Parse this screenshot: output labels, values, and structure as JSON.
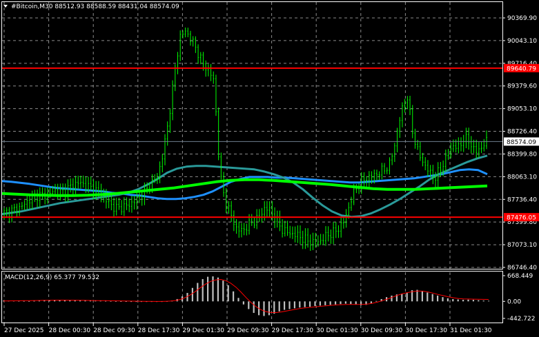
{
  "header": {
    "symbol_line": "#Bitcoin,M30  88512.93 88588.59 88431.04 88574.09"
  },
  "colors": {
    "background": "#000000",
    "grid": "#ffffff",
    "candle": "#00ff00",
    "ma_fast": "#1e90ff",
    "ma_slow": "#00ff00",
    "ma_mid": "#2a9a9a",
    "level_line": "#ff0000",
    "current_price_line": "#708090",
    "macd_hist": "#c0c0c0",
    "macd_signal": "#ff0000"
  },
  "chart_data": {
    "type": "candlestick",
    "price_axis": {
      "ticks": [
        "90369.90",
        "90043.10",
        "89716.40",
        "89379.60",
        "89053.10",
        "88726.40",
        "88399.80",
        "88063.10",
        "87736.40",
        "87399.80",
        "87073.10",
        "86746.40"
      ],
      "ylim": [
        86746.4,
        90369.9
      ]
    },
    "time_axis": {
      "ticks": [
        "27 Dec 2025",
        "28 Dec 00:30",
        "28 Dec 09:30",
        "28 Dec 17:30",
        "29 Dec 01:30",
        "29 Dec 09:30",
        "29 Dec 17:30",
        "30 Dec 01:30",
        "30 Dec 09:30",
        "30 Dec 17:30",
        "31 Dec 01:30"
      ]
    },
    "levels": [
      {
        "label": "89640.79",
        "value": 89640.79,
        "color": "#ff0000"
      },
      {
        "label": "87476.05",
        "value": 87476.05,
        "color": "#ff0000"
      }
    ],
    "current_price": {
      "label": "88574.09",
      "value": 88574.09
    },
    "close_path": [
      87540,
      87560,
      87590,
      87620,
      87700,
      87760,
      87800,
      87790,
      87820,
      87860,
      87830,
      87880,
      87940,
      87980,
      87950,
      87910,
      87870,
      87830,
      87720,
      87640,
      87600,
      87630,
      87650,
      87720,
      87780,
      87860,
      87980,
      88050,
      88400,
      88900,
      89550,
      90100,
      90180,
      90050,
      89900,
      89700,
      89620,
      89450,
      88100,
      87700,
      87500,
      87300,
      87280,
      87360,
      87420,
      87480,
      87620,
      87560,
      87420,
      87300,
      87250,
      87230,
      87200,
      87150,
      87120,
      87100,
      87150,
      87220,
      87250,
      87320,
      87430,
      87700,
      87900,
      88000,
      88050,
      88080,
      88120,
      88170,
      88250,
      88600,
      89020,
      89250,
      88700,
      88400,
      88250,
      88120,
      88050,
      88200,
      88350,
      88520,
      88480,
      88620,
      88580,
      88420,
      88480,
      88574
    ],
    "moving_averages": [
      {
        "name": "",
        "color": "#1e90ff",
        "values": [
          88000,
          87990,
          87975,
          87960,
          87940,
          87920,
          87900,
          87890,
          87880,
          87870,
          87860,
          87850,
          87830,
          87820,
          87800,
          87790,
          87770,
          87750,
          87740,
          87740,
          87750,
          87770,
          87800,
          87850,
          87920,
          87990,
          88030,
          88060,
          88060,
          88060,
          88050,
          88050,
          88040,
          88030,
          88020,
          88010,
          88000,
          87990,
          87980,
          87980,
          87990,
          88000,
          88010,
          88020,
          88030,
          88040,
          88060,
          88080,
          88100,
          88130,
          88160,
          88170,
          88160,
          88100
        ]
      },
      {
        "name": "",
        "color": "#2a9a9a",
        "values": [
          87520,
          87540,
          87560,
          87590,
          87620,
          87650,
          87680,
          87700,
          87720,
          87740,
          87760,
          87780,
          87800,
          87830,
          87880,
          87950,
          88030,
          88120,
          88180,
          88210,
          88220,
          88220,
          88210,
          88200,
          88190,
          88180,
          88170,
          88140,
          88100,
          88050,
          87980,
          87880,
          87760,
          87650,
          87560,
          87500,
          87480,
          87490,
          87530,
          87590,
          87660,
          87740,
          87830,
          87920,
          88020,
          88100,
          88160,
          88220,
          88280,
          88330,
          88370
        ]
      },
      {
        "name": "",
        "color": "#00ff00",
        "values": [
          87820,
          87810,
          87800,
          87795,
          87790,
          87790,
          87795,
          87805,
          87820,
          87840,
          87860,
          87880,
          87900,
          87930,
          87960,
          87990,
          88010,
          88020,
          88020,
          88010,
          87995,
          87980,
          87965,
          87950,
          87930,
          87910,
          87890,
          87880,
          87880,
          87880,
          87890,
          87900,
          87910,
          87920,
          87930
        ]
      }
    ]
  },
  "macd": {
    "title": "MACD(12,26,9) 65.377 79.532",
    "ticks": [
      "668.449",
      "0.00",
      "-442.722"
    ],
    "ylim": [
      -442.722,
      668.449
    ],
    "histogram": [
      20,
      18,
      15,
      12,
      10,
      8,
      12,
      18,
      25,
      35,
      40,
      38,
      35,
      30,
      28,
      25,
      22,
      20,
      18,
      15,
      12,
      10,
      8,
      5,
      2,
      0,
      -5,
      -8,
      -10,
      -12,
      -10,
      -5,
      5,
      20,
      60,
      130,
      220,
      350,
      480,
      580,
      640,
      650,
      620,
      540,
      420,
      260,
      90,
      -80,
      -200,
      -300,
      -360,
      -380,
      -360,
      -320,
      -260,
      -220,
      -200,
      -180,
      -160,
      -150,
      -140,
      -120,
      -110,
      -100,
      -90,
      -80,
      -70,
      -60,
      -70,
      -80,
      -100,
      -90,
      -50,
      10,
      60,
      110,
      150,
      180,
      200,
      230,
      290,
      300,
      270,
      230,
      190,
      150,
      110,
      80,
      60,
      50,
      40,
      45,
      40,
      30,
      20,
      15
    ],
    "signal": [
      10,
      12,
      14,
      16,
      18,
      20,
      22,
      24,
      26,
      28,
      30,
      32,
      32,
      31,
      30,
      28,
      26,
      24,
      22,
      20,
      18,
      16,
      14,
      12,
      10,
      8,
      6,
      4,
      2,
      0,
      -2,
      -1,
      1,
      8,
      22,
      50,
      100,
      170,
      260,
      360,
      450,
      520,
      560,
      570,
      540,
      470,
      370,
      240,
      100,
      -30,
      -140,
      -220,
      -270,
      -290,
      -290,
      -275,
      -250,
      -225,
      -200,
      -180,
      -165,
      -150,
      -138,
      -125,
      -113,
      -100,
      -92,
      -85,
      -80,
      -80,
      -80,
      -78,
      -70,
      -50,
      -20,
      20,
      60,
      110,
      160,
      200,
      230,
      255,
      270,
      265,
      245,
      215,
      180,
      150,
      120,
      95,
      75,
      65,
      60,
      57,
      55,
      52,
      50
    ]
  }
}
